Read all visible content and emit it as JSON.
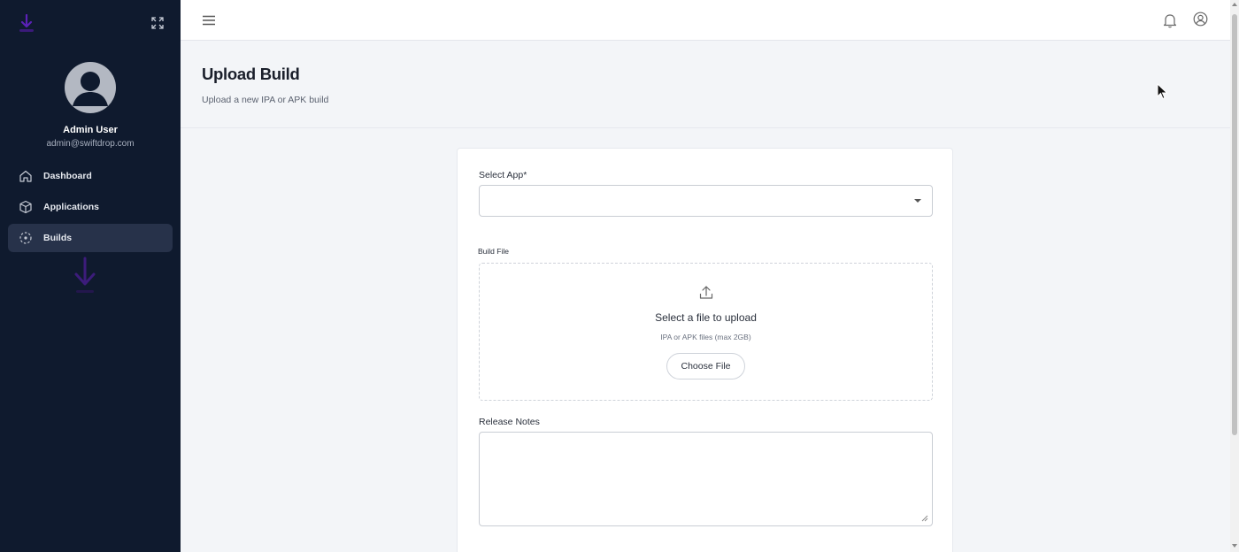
{
  "sidebar": {
    "user": {
      "name": "Admin User",
      "email": "admin@swiftdrop.com"
    },
    "items": [
      {
        "label": "Dashboard",
        "icon": "home-icon"
      },
      {
        "label": "Applications",
        "icon": "box-icon"
      },
      {
        "label": "Builds",
        "icon": "builds-icon",
        "active": true
      }
    ]
  },
  "header": {
    "title": "Upload Build",
    "subtitle": "Upload a new IPA or APK build"
  },
  "form": {
    "select_app_label": "Select App*",
    "select_app_value": "",
    "build_file_label": "Build File",
    "dropzone_title": "Select a file to upload",
    "dropzone_hint": "IPA or APK files (max 2GB)",
    "choose_file_label": "Choose File",
    "release_notes_label": "Release Notes",
    "release_notes_value": ""
  },
  "colors": {
    "sidebar_bg": "#0f1a2e",
    "accent": "#5b21b6",
    "active_item_bg": "#27324a"
  }
}
